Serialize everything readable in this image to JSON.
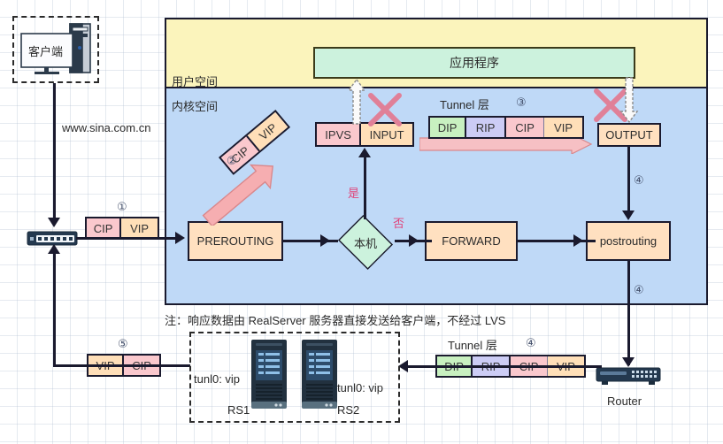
{
  "diagram": {
    "client": {
      "label": "客户端",
      "icon": "desktop-computer-icon"
    },
    "domain_label": "www.sina.com.cn",
    "note": "注：响应数据由 RealServer 服务器直接发送给客户端，不经过 LVS",
    "spaces": {
      "user": "用户空间",
      "kernel": "内核空间"
    },
    "app_box": "应用程序",
    "netfilter": {
      "ipvs": "IPVS",
      "input": "INPUT",
      "prerouting": "PREROUTING",
      "forward": "FORWARD",
      "postrouting": "postrouting",
      "output": "OUTPUT"
    },
    "decision": {
      "label": "本机",
      "yes": "是",
      "no": "否"
    },
    "steps": {
      "one": "①",
      "two": "②",
      "three": "③",
      "four_top": "④",
      "four_bottom": "④",
      "four_router": "④",
      "five": "⑤"
    },
    "packet_in": {
      "fields": [
        "CIP",
        "VIP"
      ]
    },
    "packet_diagonal": {
      "fields": [
        "CIP",
        "VIP"
      ]
    },
    "packet_return": {
      "fields": [
        "VIP",
        "CIP"
      ]
    },
    "tunnel_top": {
      "title": "Tunnel 层",
      "fields": [
        "DIP",
        "RIP",
        "CIP",
        "VIP"
      ]
    },
    "tunnel_bottom": {
      "title": "Tunnel 层",
      "fields": [
        "DIP",
        "RIP",
        "CIP",
        "VIP"
      ]
    },
    "realservers": {
      "rs1": {
        "name": "RS1",
        "iface": "tunl0: vip"
      },
      "rs2": {
        "name": "RS2",
        "iface": "tunl0: vip"
      }
    },
    "router": {
      "label": "Router",
      "icon": "router-icon"
    },
    "switch": {
      "icon": "switch-icon"
    },
    "blocked_marks": [
      {
        "name": "x-mark-input"
      },
      {
        "name": "x-mark-output"
      }
    ],
    "colors": {
      "userspace": "#fbf4bc",
      "kernelspace": "#bfd9f7",
      "app": "#ccf2dd",
      "chain": "#ffe0c0",
      "ipvs": "#ffccdd",
      "cip": "#fac8cd",
      "vip": "#ffdfb8",
      "dip": "#c8f0c0",
      "rip": "#ccccf5",
      "accent_red": "#e0457b",
      "x_mark": "#e08098",
      "line": "#1a1a2e"
    }
  }
}
